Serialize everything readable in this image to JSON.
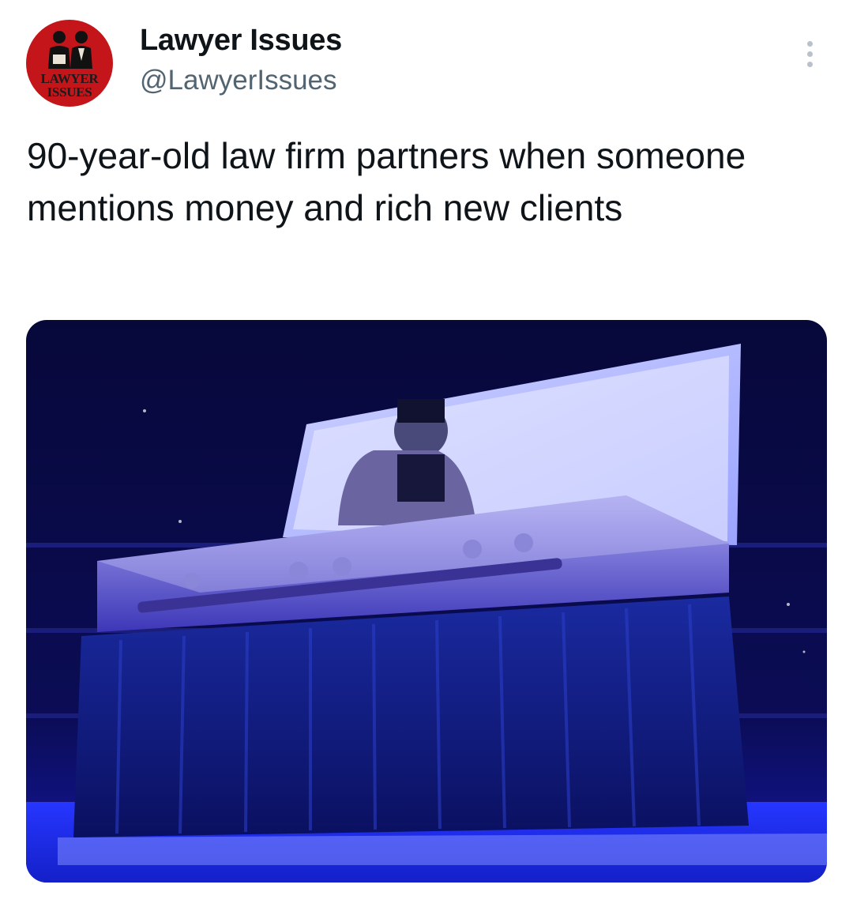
{
  "tweet": {
    "avatar": {
      "line1": "LAWYER",
      "line2": "ISSUES",
      "background": "#c4151a"
    },
    "display_name": "Lawyer Issues",
    "handle": "@LawyerIssues",
    "more_icon": "more-vertical-icon",
    "text": "90-year-old law firm partners when someone mentions money and rich new clients",
    "media_icon": "photo"
  },
  "colors": {
    "name": "#0f1419",
    "secondary": "#536471",
    "more_dots": "#b9c2ca",
    "media_dominant": "#1a1aa8"
  }
}
